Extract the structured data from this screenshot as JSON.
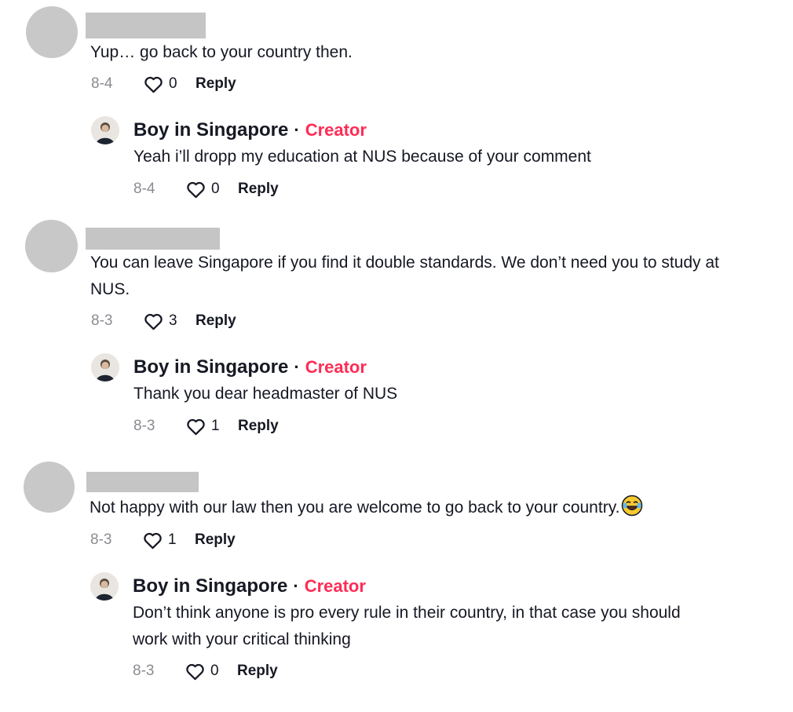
{
  "icons": {
    "like": "heart-outline-icon",
    "emoji": "face-with-tears-of-joy-icon"
  },
  "colors": {
    "creator_badge": "#fe2c55",
    "date": "#8a8b91",
    "redaction": "#c5c5c5"
  },
  "creator": {
    "name": "Boy in Singapore",
    "separator": "·",
    "badge": "Creator"
  },
  "reply_label": "Reply",
  "comments": [
    {
      "text": "Yup… go back to your country then.",
      "date": "8-4",
      "likes": "0",
      "reply": {
        "text": "Yeah i’ll dropp my education at NUS because of your comment",
        "date": "8-4",
        "likes": "0"
      }
    },
    {
      "text": "You can leave Singapore if you find it double standards. We don’t need you to study at NUS.",
      "date": "8-3",
      "likes": "3",
      "reply": {
        "text": "Thank you dear headmaster of NUS",
        "date": "8-3",
        "likes": "1"
      }
    },
    {
      "text": "Not happy with our law then you are welcome to go back to your country.",
      "date": "8-3",
      "likes": "1",
      "reply": {
        "text": "Don’t think anyone is pro every rule in their country, in that case you should work with your critical thinking",
        "date": "8-3",
        "likes": "0"
      }
    }
  ]
}
